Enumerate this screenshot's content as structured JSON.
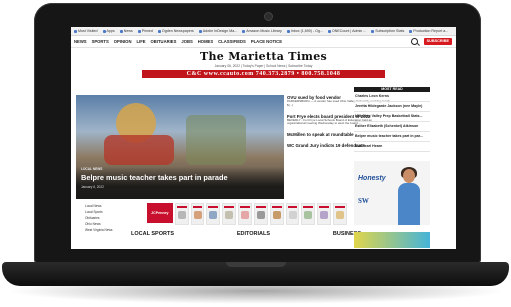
{
  "bookmarks": [
    {
      "label": "Most Visited"
    },
    {
      "label": "Apps"
    },
    {
      "label": "News"
    },
    {
      "label": "Pinned"
    },
    {
      "label": "Ogden Newspapers"
    },
    {
      "label": "Adobe InDesign Ma..."
    },
    {
      "label": "Amazon Music Library"
    },
    {
      "label": "Inbox (1,690) - Og..."
    },
    {
      "label": "ONECount | Admin ..."
    },
    {
      "label": "Subscription Stats"
    },
    {
      "label": "Production Report a..."
    }
  ],
  "nav": {
    "items": [
      "NEWS",
      "SPORTS",
      "OPINION",
      "LIFE",
      "OBITUARIES",
      "JOBS",
      "HOMES",
      "CLASSIFIEDS",
      "PLACE NOTICE"
    ],
    "subscribe_label": "SUBSCRIBE"
  },
  "masthead": {
    "title": "The Marietta Times",
    "dateline": "January 06, 2022  |  Today's Paper  |  School News  |  Subscribe Today"
  },
  "top_ad": {
    "text": "C&C    www.ccauto.com    740.373.2879 • 800.758.1048"
  },
  "hero": {
    "label": "LOCAL NEWS",
    "title": "Belpre music teacher takes part in parade",
    "date": "January 6, 2022"
  },
  "stories": [
    {
      "title": "OVU sued by food vendor",
      "text": "PARKERSBURG — A vendor has sued Ohio Valley University, seeking nearly $(...)"
    },
    {
      "title": "Fort Frye elects board president of 2022",
      "text": "BEVERLY - Fort Frye Local Schools Board of Education held an organizational meeting Wednesday to elect the board ..."
    },
    {
      "title": "McMillen to speak at roundtable",
      "text": ""
    },
    {
      "title": "WC Grand Jury indicts 19 defendants",
      "text": ""
    }
  ],
  "more_local_news": "more local news",
  "most_read": {
    "heading": "MOST READ",
    "items": [
      "Charles Leon Kerns",
      "Jeretta Hildegarde Jackson (nee Mayle)",
      "Mid-Ohio Valley Prep Basketball Stats...",
      "Esther Elizabeth (Schenkel) Atkinson",
      "Belpre music teacher takes part in par...",
      "Eva Pearl Hearn"
    ]
  },
  "side_ad": {
    "word": "Honesty",
    "logo": "SW"
  },
  "left_links": [
    "Local News",
    "Local Sports",
    "Obituaries",
    "Ohio News",
    "West Virginia News"
  ],
  "ad_row": {
    "store": "JCPenney"
  },
  "sections": [
    "LOCAL SPORTS",
    "EDITORIALS",
    "BUSINESS"
  ]
}
